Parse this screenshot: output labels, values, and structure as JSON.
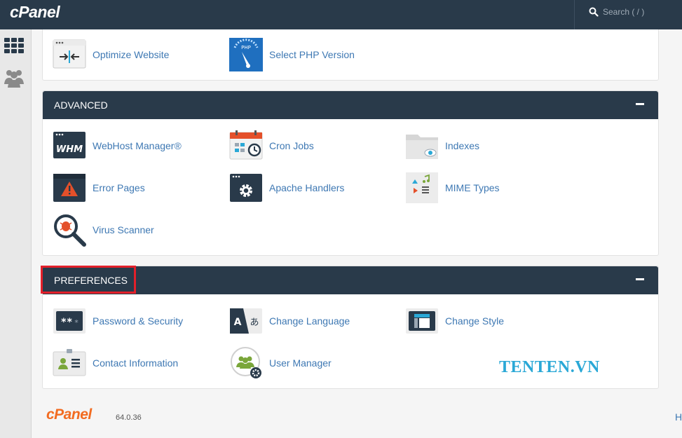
{
  "header": {
    "brand": "cPanel",
    "search_placeholder": "Search ( / )"
  },
  "top_section": {
    "items": [
      {
        "label": "Optimize Website",
        "icon": "optimize-website-icon"
      },
      {
        "label": "Select PHP Version",
        "icon": "php-gauge-icon"
      }
    ]
  },
  "advanced": {
    "title": "ADVANCED",
    "items": [
      {
        "label": "WebHost Manager®",
        "icon": "whm-icon"
      },
      {
        "label": "Cron Jobs",
        "icon": "calendar-icon"
      },
      {
        "label": "Indexes",
        "icon": "folder-eye-icon"
      },
      {
        "label": "Error Pages",
        "icon": "warning-icon"
      },
      {
        "label": "Apache Handlers",
        "icon": "gear-window-icon"
      },
      {
        "label": "MIME Types",
        "icon": "mime-icon"
      },
      {
        "label": "Virus Scanner",
        "icon": "magnifier-bug-icon"
      }
    ]
  },
  "preferences": {
    "title": "PREFERENCES",
    "items": [
      {
        "label": "Password & Security",
        "icon": "password-icon"
      },
      {
        "label": "Change Language",
        "icon": "language-icon"
      },
      {
        "label": "Change Style",
        "icon": "style-icon"
      },
      {
        "label": "Contact Information",
        "icon": "contact-card-icon"
      },
      {
        "label": "User Manager",
        "icon": "user-manager-icon"
      }
    ]
  },
  "watermark": "TENTEN.VN",
  "footer": {
    "brand": "cPanel",
    "version": "64.0.36",
    "edge_text": "H"
  },
  "colors": {
    "header_bg": "#293a4a",
    "link": "#3e78b3",
    "highlight": "#e3202a",
    "footer_brand": "#f26c21",
    "watermark": "#2aa8d6"
  }
}
